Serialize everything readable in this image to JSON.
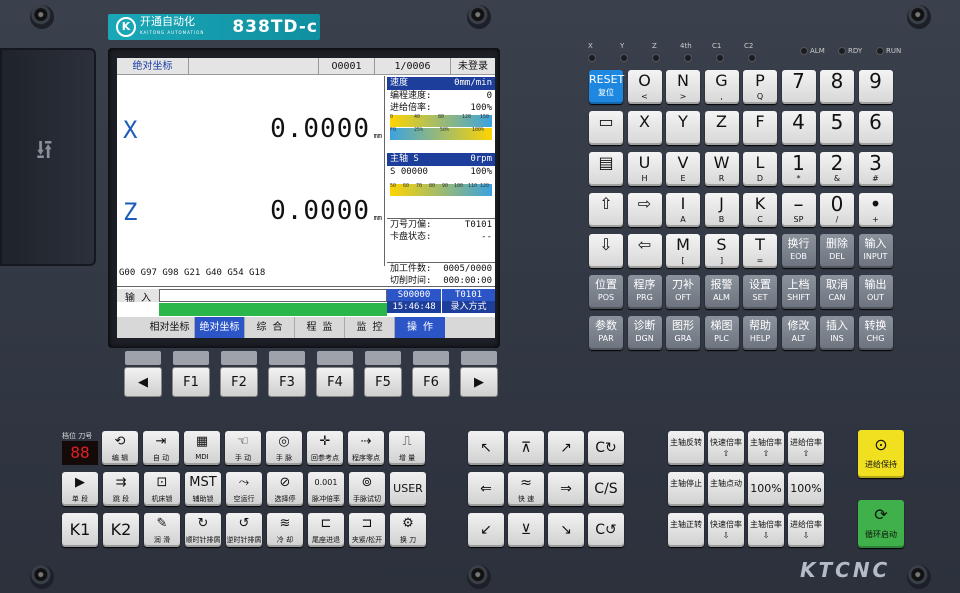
{
  "brand": {
    "company": "开通自动化",
    "tagline": "KAITONG AUTOMATION",
    "model": "838TD-c",
    "footer": "KTCNC"
  },
  "screen": {
    "header": [
      "绝对坐标",
      "",
      "O0001",
      "1/0006",
      "未登录"
    ],
    "axes": [
      {
        "name": "X",
        "value": "0.0000",
        "unit": "mm"
      },
      {
        "name": "Z",
        "value": "0.0000",
        "unit": "mm"
      }
    ],
    "gcodes": "G00 G97 G98 G21 G40 G54 G18",
    "speed_title": "速度",
    "speed_unit": "0mm/min",
    "prog_speed_label": "编程速度:",
    "prog_speed_value": "0",
    "feed_rate_label": "进给倍率:",
    "feed_rate_value": "100%",
    "feed_scale": [
      "0",
      "40",
      "80",
      "120",
      "150"
    ],
    "feed_scale2": [
      "F0",
      "25%",
      "50%",
      "100%"
    ],
    "spindle_title": "主轴 S",
    "spindle_unit": "0rpm",
    "spindle_s": "S 00000",
    "spindle_pct": "100%",
    "spindle_scale": [
      "50",
      "60",
      "70",
      "80",
      "90",
      "100",
      "110",
      "120"
    ],
    "tool_label": "刀号刀偏:",
    "tool_value": "T0101",
    "chuck_label": "卡盘状态:",
    "chuck_value": "--",
    "parts_label": "加工件数:",
    "parts_value": "0005/0000",
    "cut_time_label": "切削时间:",
    "cut_time_value": "000:00:00",
    "input_label": "输 入",
    "s_value": "S00000",
    "t_value": "T0101",
    "clock": "15:46:48",
    "mode": "录入方式",
    "softkeys": [
      "相对坐标",
      "绝对坐标",
      "综 合",
      "程 监",
      "监 控",
      "操 作"
    ]
  },
  "fkeys": [
    "◀",
    "F1",
    "F2",
    "F3",
    "F4",
    "F5",
    "F6",
    "▶"
  ],
  "leds": [
    "X",
    "Y",
    "Z",
    "4th",
    "C1",
    "C2"
  ],
  "status_leds": [
    "ALM",
    "RDY",
    "RUN"
  ],
  "keypad": [
    [
      {
        "m": "RESET",
        "s": "复位"
      },
      {
        "m": "O",
        "s": "<"
      },
      {
        "m": "N",
        "s": ">"
      },
      {
        "m": "G",
        "s": ","
      },
      {
        "m": "P",
        "s": "Q"
      },
      {
        "m": "7",
        "s": ""
      },
      {
        "m": "8",
        "s": ""
      },
      {
        "m": "9",
        "s": ""
      }
    ],
    [
      {
        "m": "▭",
        "s": ""
      },
      {
        "m": "X",
        "s": ""
      },
      {
        "m": "Y",
        "s": ""
      },
      {
        "m": "Z",
        "s": ""
      },
      {
        "m": "F",
        "s": ""
      },
      {
        "m": "4",
        "s": ""
      },
      {
        "m": "5",
        "s": ""
      },
      {
        "m": "6",
        "s": ""
      }
    ],
    [
      {
        "m": "▤",
        "s": ""
      },
      {
        "m": "U",
        "s": "H"
      },
      {
        "m": "V",
        "s": "E"
      },
      {
        "m": "W",
        "s": "R"
      },
      {
        "m": "L",
        "s": "D"
      },
      {
        "m": "1",
        "s": "*"
      },
      {
        "m": "2",
        "s": "&"
      },
      {
        "m": "3",
        "s": "#"
      }
    ],
    [
      {
        "m": "⇧",
        "s": ""
      },
      {
        "m": "⇨",
        "s": ""
      },
      {
        "m": "I",
        "s": "A"
      },
      {
        "m": "J",
        "s": "B"
      },
      {
        "m": "K",
        "s": "C"
      },
      {
        "m": "–",
        "s": "SP"
      },
      {
        "m": "0",
        "s": "/"
      },
      {
        "m": "•",
        "s": "+"
      }
    ],
    [
      {
        "m": "⇩",
        "s": ""
      },
      {
        "m": "⇦",
        "s": ""
      },
      {
        "m": "M",
        "s": "["
      },
      {
        "m": "S",
        "s": "]"
      },
      {
        "m": "T",
        "s": "="
      },
      {
        "m": "换行",
        "s": "EOB"
      },
      {
        "m": "删除",
        "s": "DEL"
      },
      {
        "m": "输入",
        "s": "INPUT"
      }
    ],
    [
      {
        "m": "位置",
        "s": "POS"
      },
      {
        "m": "程序",
        "s": "PRG"
      },
      {
        "m": "刀补",
        "s": "OFT"
      },
      {
        "m": "报警",
        "s": "ALM"
      },
      {
        "m": "设置",
        "s": "SET"
      },
      {
        "m": "上档",
        "s": "SHIFT"
      },
      {
        "m": "取消",
        "s": "CAN"
      },
      {
        "m": "输出",
        "s": "OUT"
      }
    ],
    [
      {
        "m": "参数",
        "s": "PAR"
      },
      {
        "m": "诊断",
        "s": "DGN"
      },
      {
        "m": "图形",
        "s": "GRA"
      },
      {
        "m": "梯图",
        "s": "PLC"
      },
      {
        "m": "帮助",
        "s": "HELP"
      },
      {
        "m": "修改",
        "s": "ALT"
      },
      {
        "m": "插入",
        "s": "INS"
      },
      {
        "m": "转换",
        "s": "CHG"
      }
    ]
  ],
  "seg_display": "88",
  "seg_labels": "档位 刀号",
  "op_left": [
    [
      {
        "i": "⟲",
        "t": "编 辑"
      },
      {
        "i": "⇥",
        "t": "自 动"
      },
      {
        "i": "▦",
        "t": "MDI"
      },
      {
        "i": "☜",
        "t": "手 动"
      },
      {
        "i": "◎",
        "t": "手 脉"
      },
      {
        "i": "✛",
        "t": "回参考点"
      },
      {
        "i": "⇢",
        "t": "程序零点"
      },
      {
        "i": "⎍",
        "t": "增 量"
      }
    ],
    [
      {
        "i": "▶",
        "t": "单 段"
      },
      {
        "i": "⇉",
        "t": "跳 段"
      },
      {
        "i": "⊡",
        "t": "机床锁"
      },
      {
        "i": "MST",
        "t": "辅助锁"
      },
      {
        "i": "⤳",
        "t": "空运行"
      },
      {
        "i": "⊘",
        "t": "选择停"
      },
      {
        "i": "0.001",
        "t": "脉冲倍率"
      },
      {
        "i": "⊚",
        "t": "手脉试切"
      },
      {
        "i": "USER",
        "t": ""
      }
    ],
    [
      {
        "i": "K1",
        "t": ""
      },
      {
        "i": "K2",
        "t": ""
      },
      {
        "i": "✎",
        "t": "润 滑"
      },
      {
        "i": "↻",
        "t": "顺时针排屑"
      },
      {
        "i": "↺",
        "t": "逆时针排屑"
      },
      {
        "i": "≋",
        "t": "冷 却"
      },
      {
        "i": "⊏",
        "t": "尾座进退"
      },
      {
        "i": "⊐",
        "t": "夹紧/松开"
      },
      {
        "i": "⚙",
        "t": "换 刀"
      }
    ]
  ],
  "op_mid": [
    [
      {
        "i": "↖"
      },
      {
        "i": "⊼"
      },
      {
        "i": "↗"
      },
      {
        "i": "C↻"
      }
    ],
    [
      {
        "i": "⇐"
      },
      {
        "i": "≈",
        "t": "快 速"
      },
      {
        "i": "⇒"
      },
      {
        "i": "C/S"
      }
    ],
    [
      {
        "i": "↙"
      },
      {
        "i": "⊻"
      },
      {
        "i": "↘"
      },
      {
        "i": "C↺"
      }
    ]
  ],
  "op_right": [
    [
      {
        "t": "主轴反转"
      },
      {
        "t": "快速倍率⇧"
      },
      {
        "t": "主轴倍率⇧"
      },
      {
        "t": "进给倍率⇧"
      }
    ],
    [
      {
        "t": "主轴停止"
      },
      {
        "t": "主轴点动"
      },
      {
        "t": "100%"
      },
      {
        "t": "100%"
      }
    ],
    [
      {
        "t": "主轴正转"
      },
      {
        "t": "快速倍率⇩"
      },
      {
        "t": "主轴倍率⇩"
      },
      {
        "t": "进给倍率⇩"
      }
    ]
  ],
  "feed_hold": "进给保持",
  "cycle_start": "循环启动"
}
